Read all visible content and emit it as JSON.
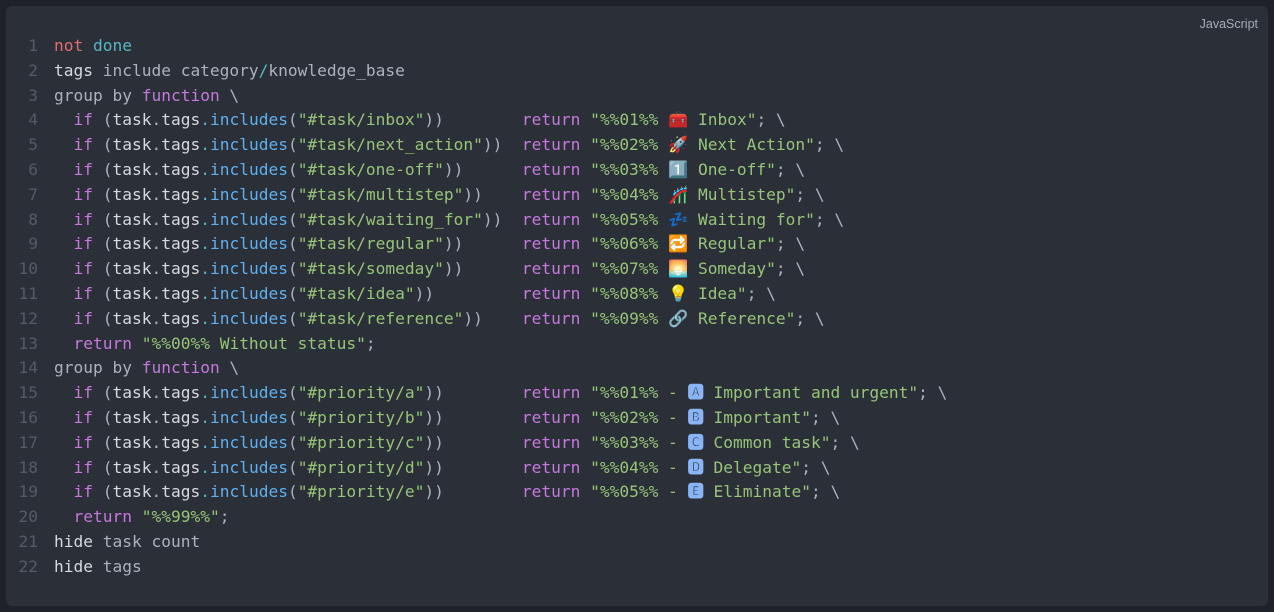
{
  "language_label": "JavaScript",
  "lines": [
    {
      "n": 1,
      "tokens": [
        {
          "t": "not",
          "c": "c-red"
        },
        {
          "t": " ",
          "c": "c-default"
        },
        {
          "t": "done",
          "c": "c-teal"
        }
      ]
    },
    {
      "n": 2,
      "tokens": [
        {
          "t": "tags",
          "c": "c-white"
        },
        {
          "t": " include category",
          "c": "c-default"
        },
        {
          "t": "/",
          "c": "c-teal"
        },
        {
          "t": "knowledge_base",
          "c": "c-default"
        }
      ]
    },
    {
      "n": 3,
      "tokens": [
        {
          "t": "group by ",
          "c": "c-default"
        },
        {
          "t": "function",
          "c": "c-mag"
        },
        {
          "t": " \\",
          "c": "c-default"
        }
      ]
    },
    {
      "n": 4,
      "tokens": [
        {
          "t": "  ",
          "c": "c-default"
        },
        {
          "t": "if",
          "c": "c-mag"
        },
        {
          "t": " (",
          "c": "c-default"
        },
        {
          "t": "task",
          "c": "c-white"
        },
        {
          "t": ".",
          "c": "c-default"
        },
        {
          "t": "tags",
          "c": "c-white"
        },
        {
          "t": ".",
          "c": "c-teal"
        },
        {
          "t": "includes",
          "c": "c-blue"
        },
        {
          "t": "(",
          "c": "c-default"
        },
        {
          "t": "\"#task/inbox\"",
          "c": "c-green"
        },
        {
          "t": "))        ",
          "c": "c-default"
        },
        {
          "t": "return",
          "c": "c-mag"
        },
        {
          "t": " ",
          "c": "c-default"
        },
        {
          "t": "\"%%01%% 🧰 Inbox\"",
          "c": "c-green"
        },
        {
          "t": "; \\",
          "c": "c-default"
        }
      ]
    },
    {
      "n": 5,
      "tokens": [
        {
          "t": "  ",
          "c": "c-default"
        },
        {
          "t": "if",
          "c": "c-mag"
        },
        {
          "t": " (",
          "c": "c-default"
        },
        {
          "t": "task",
          "c": "c-white"
        },
        {
          "t": ".",
          "c": "c-default"
        },
        {
          "t": "tags",
          "c": "c-white"
        },
        {
          "t": ".",
          "c": "c-teal"
        },
        {
          "t": "includes",
          "c": "c-blue"
        },
        {
          "t": "(",
          "c": "c-default"
        },
        {
          "t": "\"#task/next_action\"",
          "c": "c-green"
        },
        {
          "t": "))  ",
          "c": "c-default"
        },
        {
          "t": "return",
          "c": "c-mag"
        },
        {
          "t": " ",
          "c": "c-default"
        },
        {
          "t": "\"%%02%% 🚀 Next Action\"",
          "c": "c-green"
        },
        {
          "t": "; \\",
          "c": "c-default"
        }
      ]
    },
    {
      "n": 6,
      "tokens": [
        {
          "t": "  ",
          "c": "c-default"
        },
        {
          "t": "if",
          "c": "c-mag"
        },
        {
          "t": " (",
          "c": "c-default"
        },
        {
          "t": "task",
          "c": "c-white"
        },
        {
          "t": ".",
          "c": "c-default"
        },
        {
          "t": "tags",
          "c": "c-white"
        },
        {
          "t": ".",
          "c": "c-teal"
        },
        {
          "t": "includes",
          "c": "c-blue"
        },
        {
          "t": "(",
          "c": "c-default"
        },
        {
          "t": "\"#task/one-off\"",
          "c": "c-green"
        },
        {
          "t": "))      ",
          "c": "c-default"
        },
        {
          "t": "return",
          "c": "c-mag"
        },
        {
          "t": " ",
          "c": "c-default"
        },
        {
          "t": "\"%%03%% 1️⃣ One-off\"",
          "c": "c-green"
        },
        {
          "t": "; \\",
          "c": "c-default"
        }
      ]
    },
    {
      "n": 7,
      "tokens": [
        {
          "t": "  ",
          "c": "c-default"
        },
        {
          "t": "if",
          "c": "c-mag"
        },
        {
          "t": " (",
          "c": "c-default"
        },
        {
          "t": "task",
          "c": "c-white"
        },
        {
          "t": ".",
          "c": "c-default"
        },
        {
          "t": "tags",
          "c": "c-white"
        },
        {
          "t": ".",
          "c": "c-teal"
        },
        {
          "t": "includes",
          "c": "c-blue"
        },
        {
          "t": "(",
          "c": "c-default"
        },
        {
          "t": "\"#task/multistep\"",
          "c": "c-green"
        },
        {
          "t": "))    ",
          "c": "c-default"
        },
        {
          "t": "return",
          "c": "c-mag"
        },
        {
          "t": " ",
          "c": "c-default"
        },
        {
          "t": "\"%%04%% 🎢 Multistep\"",
          "c": "c-green"
        },
        {
          "t": "; \\",
          "c": "c-default"
        }
      ]
    },
    {
      "n": 8,
      "tokens": [
        {
          "t": "  ",
          "c": "c-default"
        },
        {
          "t": "if",
          "c": "c-mag"
        },
        {
          "t": " (",
          "c": "c-default"
        },
        {
          "t": "task",
          "c": "c-white"
        },
        {
          "t": ".",
          "c": "c-default"
        },
        {
          "t": "tags",
          "c": "c-white"
        },
        {
          "t": ".",
          "c": "c-teal"
        },
        {
          "t": "includes",
          "c": "c-blue"
        },
        {
          "t": "(",
          "c": "c-default"
        },
        {
          "t": "\"#task/waiting_for\"",
          "c": "c-green"
        },
        {
          "t": "))  ",
          "c": "c-default"
        },
        {
          "t": "return",
          "c": "c-mag"
        },
        {
          "t": " ",
          "c": "c-default"
        },
        {
          "t": "\"%%05%% 💤 Waiting for\"",
          "c": "c-green"
        },
        {
          "t": "; \\",
          "c": "c-default"
        }
      ]
    },
    {
      "n": 9,
      "tokens": [
        {
          "t": "  ",
          "c": "c-default"
        },
        {
          "t": "if",
          "c": "c-mag"
        },
        {
          "t": " (",
          "c": "c-default"
        },
        {
          "t": "task",
          "c": "c-white"
        },
        {
          "t": ".",
          "c": "c-default"
        },
        {
          "t": "tags",
          "c": "c-white"
        },
        {
          "t": ".",
          "c": "c-teal"
        },
        {
          "t": "includes",
          "c": "c-blue"
        },
        {
          "t": "(",
          "c": "c-default"
        },
        {
          "t": "\"#task/regular\"",
          "c": "c-green"
        },
        {
          "t": "))      ",
          "c": "c-default"
        },
        {
          "t": "return",
          "c": "c-mag"
        },
        {
          "t": " ",
          "c": "c-default"
        },
        {
          "t": "\"%%06%% 🔁 Regular\"",
          "c": "c-green"
        },
        {
          "t": "; \\",
          "c": "c-default"
        }
      ]
    },
    {
      "n": 10,
      "tokens": [
        {
          "t": "  ",
          "c": "c-default"
        },
        {
          "t": "if",
          "c": "c-mag"
        },
        {
          "t": " (",
          "c": "c-default"
        },
        {
          "t": "task",
          "c": "c-white"
        },
        {
          "t": ".",
          "c": "c-default"
        },
        {
          "t": "tags",
          "c": "c-white"
        },
        {
          "t": ".",
          "c": "c-teal"
        },
        {
          "t": "includes",
          "c": "c-blue"
        },
        {
          "t": "(",
          "c": "c-default"
        },
        {
          "t": "\"#task/someday\"",
          "c": "c-green"
        },
        {
          "t": "))      ",
          "c": "c-default"
        },
        {
          "t": "return",
          "c": "c-mag"
        },
        {
          "t": " ",
          "c": "c-default"
        },
        {
          "t": "\"%%07%% 🌅 Someday\"",
          "c": "c-green"
        },
        {
          "t": "; \\",
          "c": "c-default"
        }
      ]
    },
    {
      "n": 11,
      "tokens": [
        {
          "t": "  ",
          "c": "c-default"
        },
        {
          "t": "if",
          "c": "c-mag"
        },
        {
          "t": " (",
          "c": "c-default"
        },
        {
          "t": "task",
          "c": "c-white"
        },
        {
          "t": ".",
          "c": "c-default"
        },
        {
          "t": "tags",
          "c": "c-white"
        },
        {
          "t": ".",
          "c": "c-teal"
        },
        {
          "t": "includes",
          "c": "c-blue"
        },
        {
          "t": "(",
          "c": "c-default"
        },
        {
          "t": "\"#task/idea\"",
          "c": "c-green"
        },
        {
          "t": "))         ",
          "c": "c-default"
        },
        {
          "t": "return",
          "c": "c-mag"
        },
        {
          "t": " ",
          "c": "c-default"
        },
        {
          "t": "\"%%08%% 💡 Idea\"",
          "c": "c-green"
        },
        {
          "t": "; \\",
          "c": "c-default"
        }
      ]
    },
    {
      "n": 12,
      "tokens": [
        {
          "t": "  ",
          "c": "c-default"
        },
        {
          "t": "if",
          "c": "c-mag"
        },
        {
          "t": " (",
          "c": "c-default"
        },
        {
          "t": "task",
          "c": "c-white"
        },
        {
          "t": ".",
          "c": "c-default"
        },
        {
          "t": "tags",
          "c": "c-white"
        },
        {
          "t": ".",
          "c": "c-teal"
        },
        {
          "t": "includes",
          "c": "c-blue"
        },
        {
          "t": "(",
          "c": "c-default"
        },
        {
          "t": "\"#task/reference\"",
          "c": "c-green"
        },
        {
          "t": "))    ",
          "c": "c-default"
        },
        {
          "t": "return",
          "c": "c-mag"
        },
        {
          "t": " ",
          "c": "c-default"
        },
        {
          "t": "\"%%09%% 🔗 Reference\"",
          "c": "c-green"
        },
        {
          "t": "; \\",
          "c": "c-default"
        }
      ]
    },
    {
      "n": 13,
      "tokens": [
        {
          "t": "  ",
          "c": "c-default"
        },
        {
          "t": "return",
          "c": "c-mag"
        },
        {
          "t": " ",
          "c": "c-default"
        },
        {
          "t": "\"%%00%% Without status\"",
          "c": "c-green"
        },
        {
          "t": ";",
          "c": "c-default"
        }
      ]
    },
    {
      "n": 14,
      "tokens": [
        {
          "t": "group by ",
          "c": "c-default"
        },
        {
          "t": "function",
          "c": "c-mag"
        },
        {
          "t": " \\",
          "c": "c-default"
        }
      ]
    },
    {
      "n": 15,
      "tokens": [
        {
          "t": "  ",
          "c": "c-default"
        },
        {
          "t": "if",
          "c": "c-mag"
        },
        {
          "t": " (",
          "c": "c-default"
        },
        {
          "t": "task",
          "c": "c-white"
        },
        {
          "t": ".",
          "c": "c-default"
        },
        {
          "t": "tags",
          "c": "c-white"
        },
        {
          "t": ".",
          "c": "c-teal"
        },
        {
          "t": "includes",
          "c": "c-blue"
        },
        {
          "t": "(",
          "c": "c-default"
        },
        {
          "t": "\"#priority/a\"",
          "c": "c-green"
        },
        {
          "t": "))        ",
          "c": "c-default"
        },
        {
          "t": "return",
          "c": "c-mag"
        },
        {
          "t": " ",
          "c": "c-default"
        },
        {
          "t": "\"%%01%% - ",
          "c": "c-green"
        },
        {
          "t": "🅰",
          "c": "c-priC"
        },
        {
          "t": " Important and urgent\"",
          "c": "c-green"
        },
        {
          "t": "; \\",
          "c": "c-default"
        }
      ]
    },
    {
      "n": 16,
      "tokens": [
        {
          "t": "  ",
          "c": "c-default"
        },
        {
          "t": "if",
          "c": "c-mag"
        },
        {
          "t": " (",
          "c": "c-default"
        },
        {
          "t": "task",
          "c": "c-white"
        },
        {
          "t": ".",
          "c": "c-default"
        },
        {
          "t": "tags",
          "c": "c-white"
        },
        {
          "t": ".",
          "c": "c-teal"
        },
        {
          "t": "includes",
          "c": "c-blue"
        },
        {
          "t": "(",
          "c": "c-default"
        },
        {
          "t": "\"#priority/b\"",
          "c": "c-green"
        },
        {
          "t": "))        ",
          "c": "c-default"
        },
        {
          "t": "return",
          "c": "c-mag"
        },
        {
          "t": " ",
          "c": "c-default"
        },
        {
          "t": "\"%%02%% - ",
          "c": "c-green"
        },
        {
          "t": "🅱",
          "c": "c-priC"
        },
        {
          "t": " Important\"",
          "c": "c-green"
        },
        {
          "t": "; \\",
          "c": "c-default"
        }
      ]
    },
    {
      "n": 17,
      "tokens": [
        {
          "t": "  ",
          "c": "c-default"
        },
        {
          "t": "if",
          "c": "c-mag"
        },
        {
          "t": " (",
          "c": "c-default"
        },
        {
          "t": "task",
          "c": "c-white"
        },
        {
          "t": ".",
          "c": "c-default"
        },
        {
          "t": "tags",
          "c": "c-white"
        },
        {
          "t": ".",
          "c": "c-teal"
        },
        {
          "t": "includes",
          "c": "c-blue"
        },
        {
          "t": "(",
          "c": "c-default"
        },
        {
          "t": "\"#priority/c\"",
          "c": "c-green"
        },
        {
          "t": "))        ",
          "c": "c-default"
        },
        {
          "t": "return",
          "c": "c-mag"
        },
        {
          "t": " ",
          "c": "c-default"
        },
        {
          "t": "\"%%03%% - ",
          "c": "c-green"
        },
        {
          "t": "🅲",
          "c": "c-priC"
        },
        {
          "t": " Common task\"",
          "c": "c-green"
        },
        {
          "t": "; \\",
          "c": "c-default"
        }
      ]
    },
    {
      "n": 18,
      "tokens": [
        {
          "t": "  ",
          "c": "c-default"
        },
        {
          "t": "if",
          "c": "c-mag"
        },
        {
          "t": " (",
          "c": "c-default"
        },
        {
          "t": "task",
          "c": "c-white"
        },
        {
          "t": ".",
          "c": "c-default"
        },
        {
          "t": "tags",
          "c": "c-white"
        },
        {
          "t": ".",
          "c": "c-teal"
        },
        {
          "t": "includes",
          "c": "c-blue"
        },
        {
          "t": "(",
          "c": "c-default"
        },
        {
          "t": "\"#priority/d\"",
          "c": "c-green"
        },
        {
          "t": "))        ",
          "c": "c-default"
        },
        {
          "t": "return",
          "c": "c-mag"
        },
        {
          "t": " ",
          "c": "c-default"
        },
        {
          "t": "\"%%04%% - ",
          "c": "c-green"
        },
        {
          "t": "🅳",
          "c": "c-priC"
        },
        {
          "t": " Delegate\"",
          "c": "c-green"
        },
        {
          "t": "; \\",
          "c": "c-default"
        }
      ]
    },
    {
      "n": 19,
      "tokens": [
        {
          "t": "  ",
          "c": "c-default"
        },
        {
          "t": "if",
          "c": "c-mag"
        },
        {
          "t": " (",
          "c": "c-default"
        },
        {
          "t": "task",
          "c": "c-white"
        },
        {
          "t": ".",
          "c": "c-default"
        },
        {
          "t": "tags",
          "c": "c-white"
        },
        {
          "t": ".",
          "c": "c-teal"
        },
        {
          "t": "includes",
          "c": "c-blue"
        },
        {
          "t": "(",
          "c": "c-default"
        },
        {
          "t": "\"#priority/e\"",
          "c": "c-green"
        },
        {
          "t": "))        ",
          "c": "c-default"
        },
        {
          "t": "return",
          "c": "c-mag"
        },
        {
          "t": " ",
          "c": "c-default"
        },
        {
          "t": "\"%%05%% - ",
          "c": "c-green"
        },
        {
          "t": "🅴",
          "c": "c-priC"
        },
        {
          "t": " Eliminate\"",
          "c": "c-green"
        },
        {
          "t": "; \\",
          "c": "c-default"
        }
      ]
    },
    {
      "n": 20,
      "tokens": [
        {
          "t": "  ",
          "c": "c-default"
        },
        {
          "t": "return",
          "c": "c-mag"
        },
        {
          "t": " ",
          "c": "c-default"
        },
        {
          "t": "\"%%99%%\"",
          "c": "c-green"
        },
        {
          "t": ";",
          "c": "c-default"
        }
      ]
    },
    {
      "n": 21,
      "tokens": [
        {
          "t": "hide",
          "c": "c-white"
        },
        {
          "t": " task count",
          "c": "c-default"
        }
      ]
    },
    {
      "n": 22,
      "tokens": [
        {
          "t": "hide",
          "c": "c-white"
        },
        {
          "t": " tags",
          "c": "c-default"
        }
      ]
    }
  ]
}
